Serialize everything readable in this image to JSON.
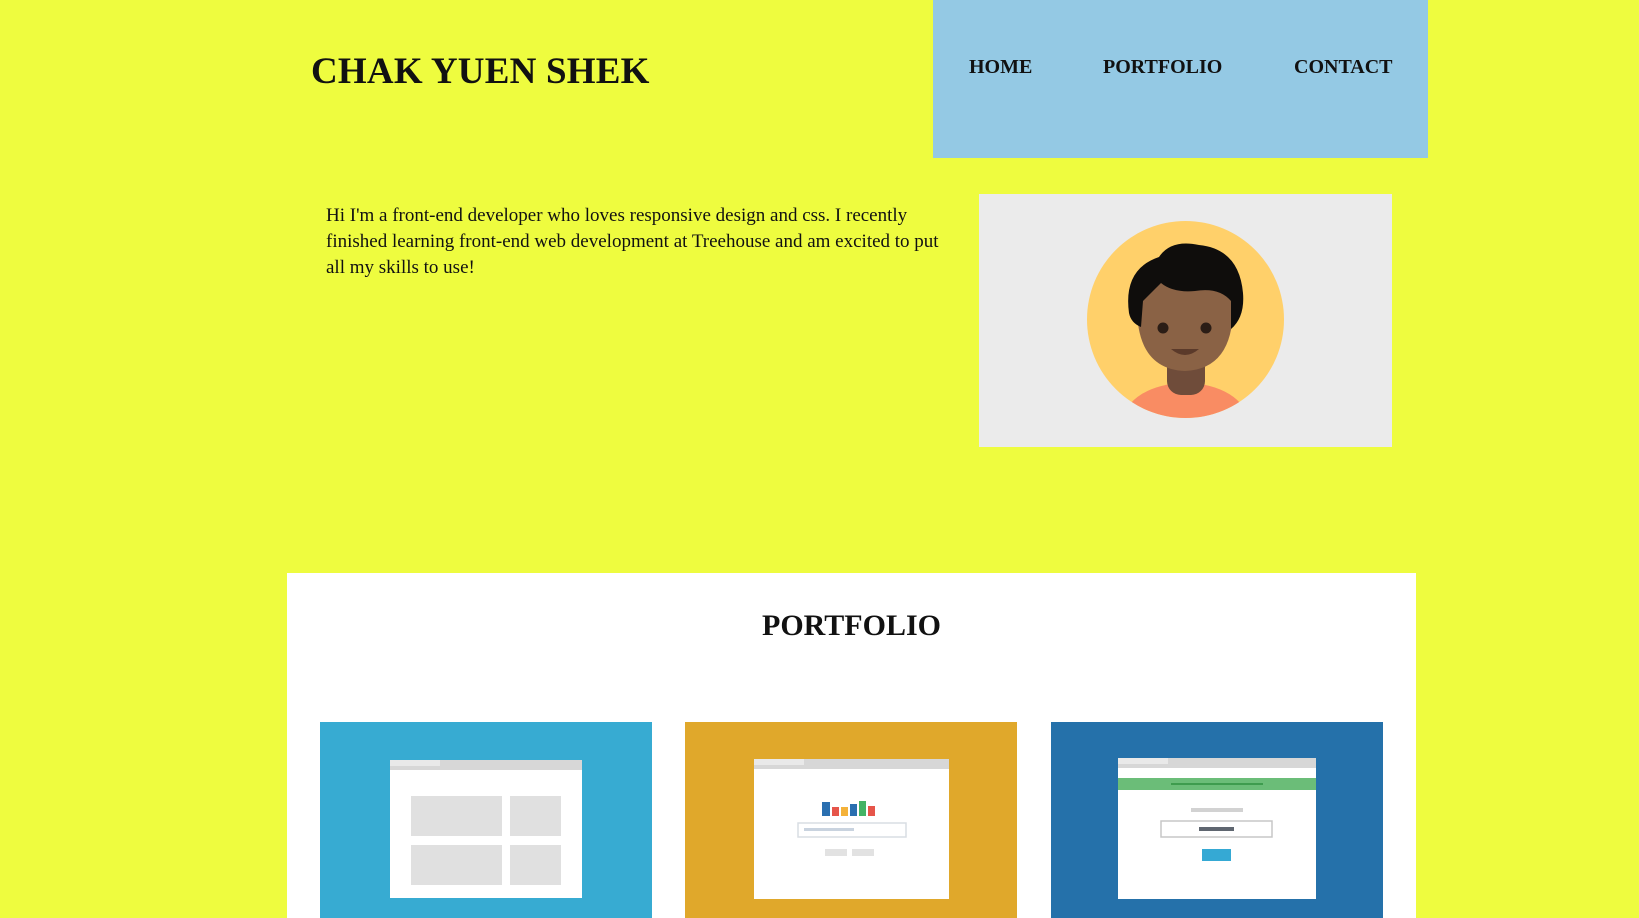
{
  "header": {
    "title": "CHAK YUEN SHEK"
  },
  "nav": {
    "items": [
      {
        "label": "HOME"
      },
      {
        "label": "PORTFOLIO"
      },
      {
        "label": "CONTACT"
      }
    ],
    "background": "#94c9e4"
  },
  "intro": {
    "text": "Hi I'm a front-end developer who loves responsive design and css. I recently finished learning front-end web development at Treehouse and am excited to put all my skills to use!"
  },
  "avatar": {
    "icon": "developer-avatar-icon"
  },
  "portfolio": {
    "title": "PORTFOLIO",
    "cards": [
      {
        "icon": "layout-wireframe-icon",
        "color": "#37abd2"
      },
      {
        "icon": "bar-chart-window-icon",
        "color": "#e0a82b"
      },
      {
        "icon": "signup-form-window-icon",
        "color": "#2571aa"
      }
    ]
  },
  "colors": {
    "page_background": "#eefc3f",
    "section_background": "#ffffff"
  }
}
